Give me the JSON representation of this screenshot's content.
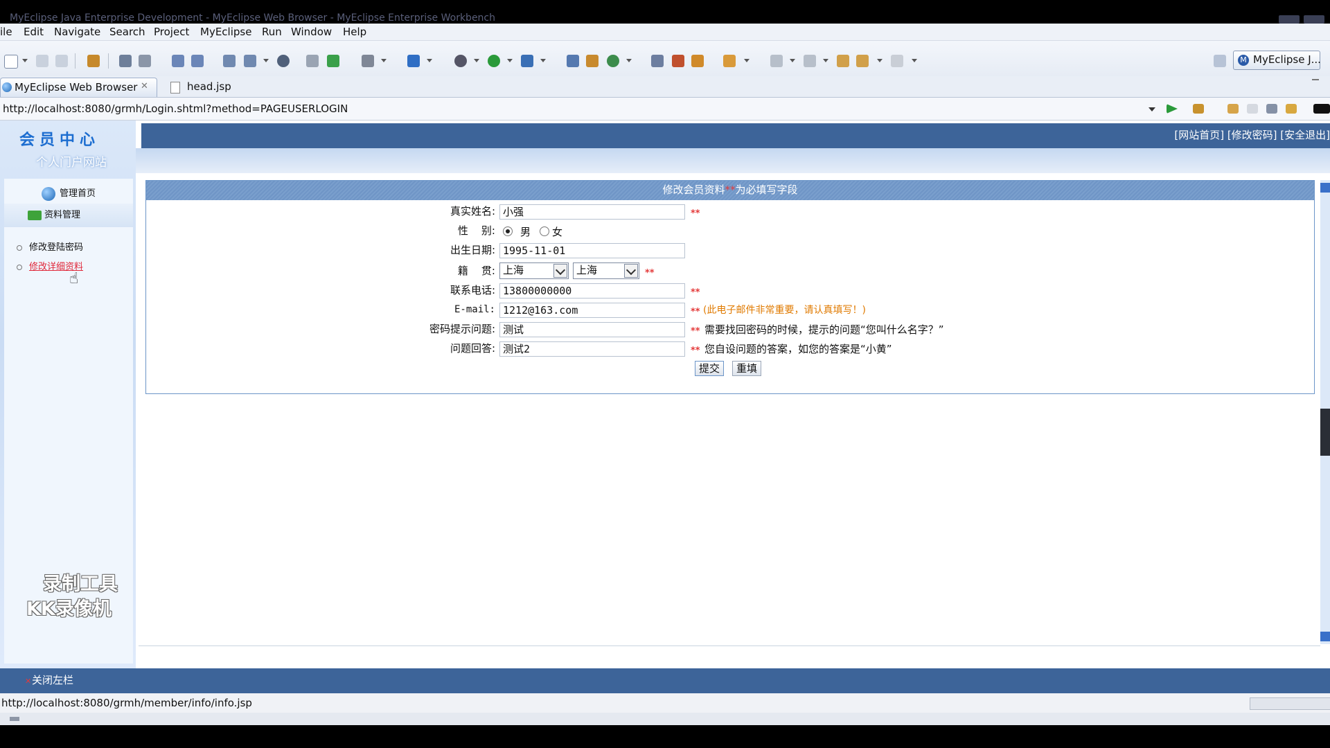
{
  "window": {
    "title": "MyEclipse Java Enterprise Development - MyEclipse Web Browser - MyEclipse Enterprise Workbench"
  },
  "menu": [
    "ile",
    "Edit",
    "Navigate",
    "Search",
    "Project",
    "MyEclipse",
    "Run",
    "Window",
    "Help"
  ],
  "perspective": {
    "label": "MyEclipse J..."
  },
  "tabs": [
    {
      "label": "MyEclipse Web Browser",
      "icon": "globe-icon",
      "active": true
    },
    {
      "label": "head.jsp",
      "icon": "jsp-file-icon",
      "active": false
    }
  ],
  "browser": {
    "url": "http://localhost:8080/grmh/Login.shtml?method=PAGEUSERLOGIN"
  },
  "site": {
    "logo_text": "会员中心",
    "subtitle": "个人门户网站",
    "top_links": "[网站首页] [修改密码] [安全退出]"
  },
  "sidebar": {
    "home": "管理首页",
    "section": "资料管理",
    "links": [
      "修改登陆密码",
      "修改详细资料"
    ]
  },
  "watermark": [
    "录制工具",
    "KK录像机"
  ],
  "form": {
    "header_title": "修改会员资料",
    "header_req": "**",
    "header_suffix": "为必填写字段",
    "req_mark": "**",
    "labels": {
      "name": "真实姓名:",
      "gender": "性    别:",
      "birth": "出生日期:",
      "origin": "籍    贯:",
      "phone": "联系电话:",
      "email": "E-mail:",
      "question": "密码提示问题:",
      "answer": "问题回答:"
    },
    "values": {
      "name": "小强",
      "gender_male": "男",
      "gender_female": "女",
      "birth": "1995-11-01",
      "province": "上海",
      "city": "上海",
      "phone": "13800000000",
      "email": "1212@163.com",
      "question": "测试",
      "answer": "测试2"
    },
    "hints": {
      "email": "(此电子邮件非常重要，请认真填写！)",
      "question": "需要找回密码的时候，提示的问题“您叫什么名字？”",
      "answer": "您自设问题的答案，如您的答案是“小黄”"
    },
    "buttons": {
      "submit": "提交",
      "reset": "重填"
    }
  },
  "footer": {
    "close_left": "关闭左栏"
  },
  "status": {
    "url": "http://localhost:8080/grmh/member/info/info.jsp"
  },
  "colors": {
    "header_blue": "#3d6499",
    "required_red": "#e43a3a",
    "hint_orange": "#e07a00"
  }
}
